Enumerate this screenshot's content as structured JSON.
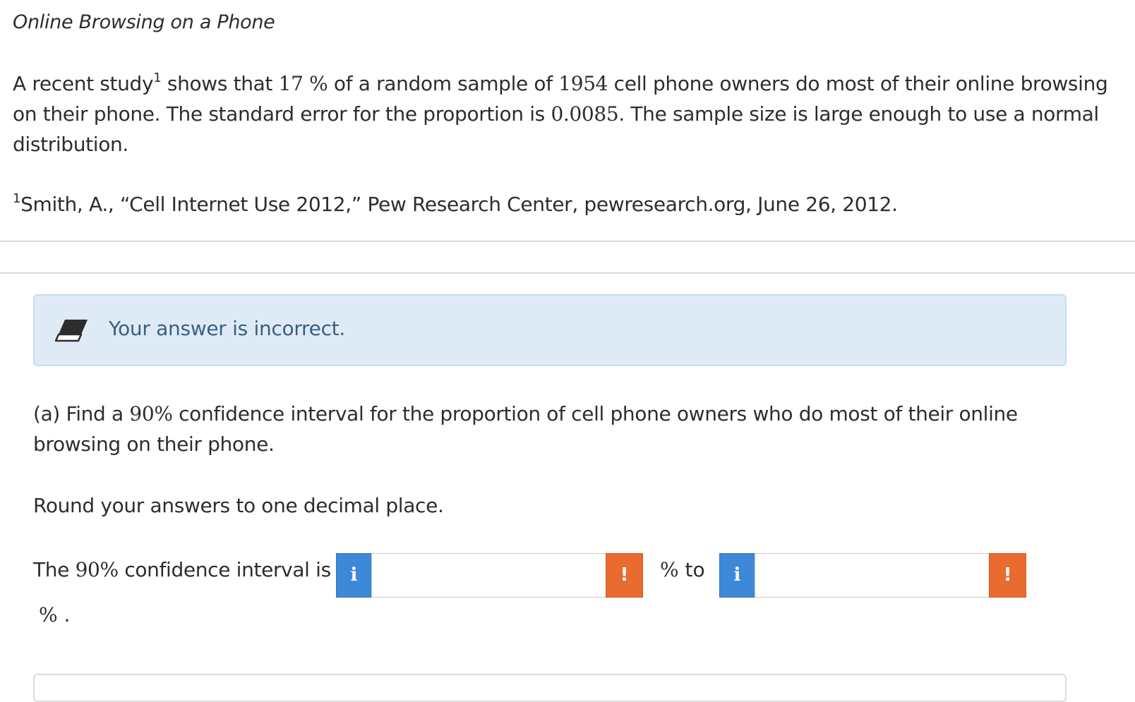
{
  "problem": {
    "title": "Online Browsing on a Phone",
    "intro": {
      "t1": "A recent study",
      "footnote_mark": "1",
      "t2": " shows that ",
      "percent_value": "17 %",
      "t3": " of a random sample of ",
      "sample_size": "1954",
      "t4": " cell phone owners do most of their online browsing on their phone. The standard error for the proportion is ",
      "standard_error": "0.0085",
      "t5": ". The sample size is large enough to use a normal distribution."
    },
    "footnote": {
      "mark": "1",
      "text": "Smith, A., “Cell Internet Use 2012,” Pew Research Center, pewresearch.org, June 26, 2012."
    }
  },
  "feedback": {
    "message": "Your answer is incorrect.",
    "icon": "eraser-icon",
    "background_color": "#deebf6",
    "text_color": "#3b5f7e"
  },
  "question_a": {
    "prefix": "(a) Find a ",
    "level": "90%",
    "rest": " confidence interval for the proportion of cell phone owners who do most of their online browsing on their phone.",
    "instruction": "Round your answers to one decimal place."
  },
  "answer": {
    "label_prefix": "The ",
    "label_level": "90%",
    "label_suffix": " confidence interval is",
    "info_glyph": "i",
    "warn_glyph": "!",
    "lower_value": "",
    "upper_value": "",
    "between_unit": "%",
    "between_word": "to",
    "end_unit": "%",
    "end_punct": ".",
    "info_color": "#3d88d8",
    "warn_color": "#ea6b2f"
  }
}
